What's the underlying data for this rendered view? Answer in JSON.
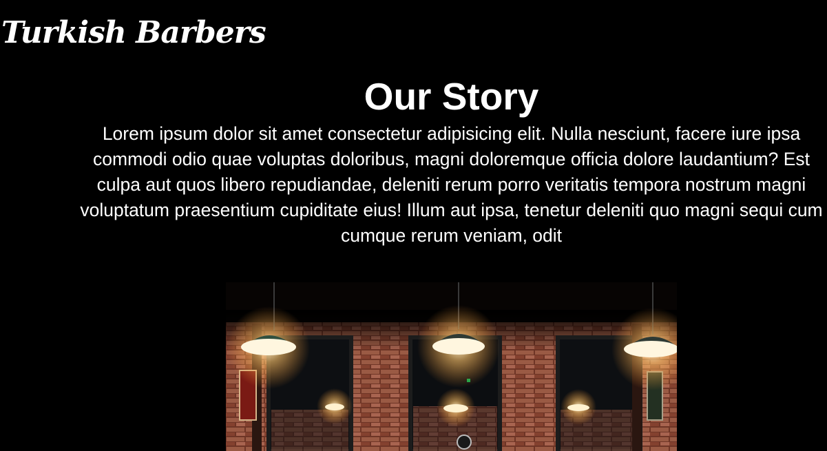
{
  "header": {
    "brand": "Turkish Barbers"
  },
  "story": {
    "title": "Our Story",
    "text": "Lorem ipsum dolor sit amet consectetur adipisicing elit. Nulla nesciunt, facere iure ipsa commodi odio quae voluptas doloribus, magni doloremque officia dolore laudantium? Est culpa aut quos libero repudiandae, deleniti rerum porro veritatis tempora nostrum magni voluptatum praesentium cupiditate eius! Illum aut ipsa, tenetur deleniti quo magni sequi cum cumque rerum veniam, odit"
  },
  "colors": {
    "background": "#000000",
    "text": "#ffffff",
    "lamp_glow": "#ffd9a0",
    "brick": "#8a4a34"
  }
}
